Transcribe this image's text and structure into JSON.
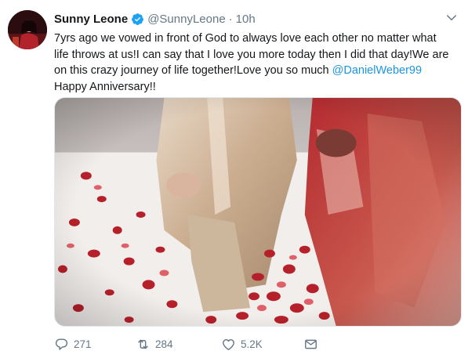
{
  "tweet": {
    "display_name": "Sunny Leone",
    "handle": "@SunnyLeone",
    "separator": "·",
    "time": "10h",
    "text_lines": [
      "7yrs ago we vowed in front of God to always love each other no matter what",
      "life throws at us!I can say that I love you more today then I did that day!We are",
      "on this crazy journey of life together!Love you so much "
    ],
    "mention": "@DanielWeber99",
    "last_line": "Happy Anniversary!!"
  },
  "actions": {
    "replies": "271",
    "retweets": "284",
    "likes": "5.2K"
  },
  "colors": {
    "accent": "#1b95e0",
    "muted": "#657786",
    "verified": "#1da1f2"
  },
  "icons": {
    "verified": "verified-badge-icon",
    "caret": "chevron-down-icon",
    "reply": "reply-icon",
    "retweet": "retweet-icon",
    "like": "heart-icon",
    "dm": "direct-message-icon"
  }
}
